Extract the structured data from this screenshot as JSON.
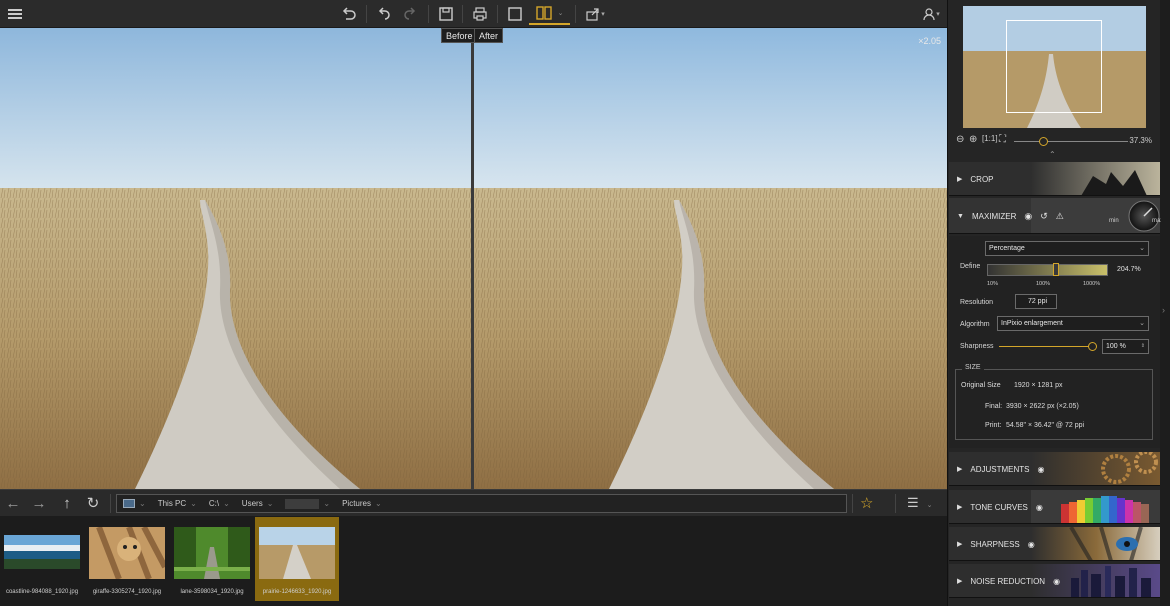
{
  "toolbar": {
    "tooltip_before": "Before",
    "tooltip_after": "After"
  },
  "viewer": {
    "zoom_tag": "×2.05"
  },
  "pathbar": {
    "crumbs": [
      "This PC",
      "C:\\",
      "Users",
      "",
      "Pictures"
    ]
  },
  "filmstrip": [
    {
      "name": "coastline-984088_1920.jpg"
    },
    {
      "name": "giraffe-3305274_1920.jpg"
    },
    {
      "name": "lane-3598034_1920.jpg"
    },
    {
      "name": "prairie-1246633_1920.jpg",
      "selected": true
    }
  ],
  "navigator": {
    "zoom_percent": "37.3%"
  },
  "sections": {
    "crop": "CROP",
    "maximizer": "MAXIMIZER",
    "adjustments": "ADJUSTMENTS",
    "tone_curves": "TONE CURVES",
    "sharpness": "SHARPNESS",
    "noise_reduction": "NOISE REDUCTION"
  },
  "maximizer": {
    "dial_min": "min",
    "dial_max": "max",
    "mode": "Percentage",
    "define_label": "Define",
    "define_value": "204.7%",
    "define_level": 0.55,
    "scale_ticks": [
      "10%",
      "100%",
      "1000%"
    ],
    "resolution_label": "Resolution",
    "resolution_value": "72 ppi",
    "algorithm_label": "Algorithm",
    "algorithm_value": "InPixio enlargement",
    "sharpness_label": "Sharpness",
    "sharpness_value": "100 %",
    "sharpness_level": 1.0,
    "size_title": "SIZE",
    "original_label": "Original Size",
    "original_value": "1920 × 1281 px",
    "final_label": "Final:",
    "final_value": "3930 × 2622 px (×2.05)",
    "print_label": "Print:",
    "print_value": "54.58\" × 36.42\" @ 72 ppi"
  },
  "colors": {
    "accent": "#d4a62a",
    "sky": "#a9c9e4",
    "grass": "#b89c6c",
    "path": "#c9c6c0"
  }
}
